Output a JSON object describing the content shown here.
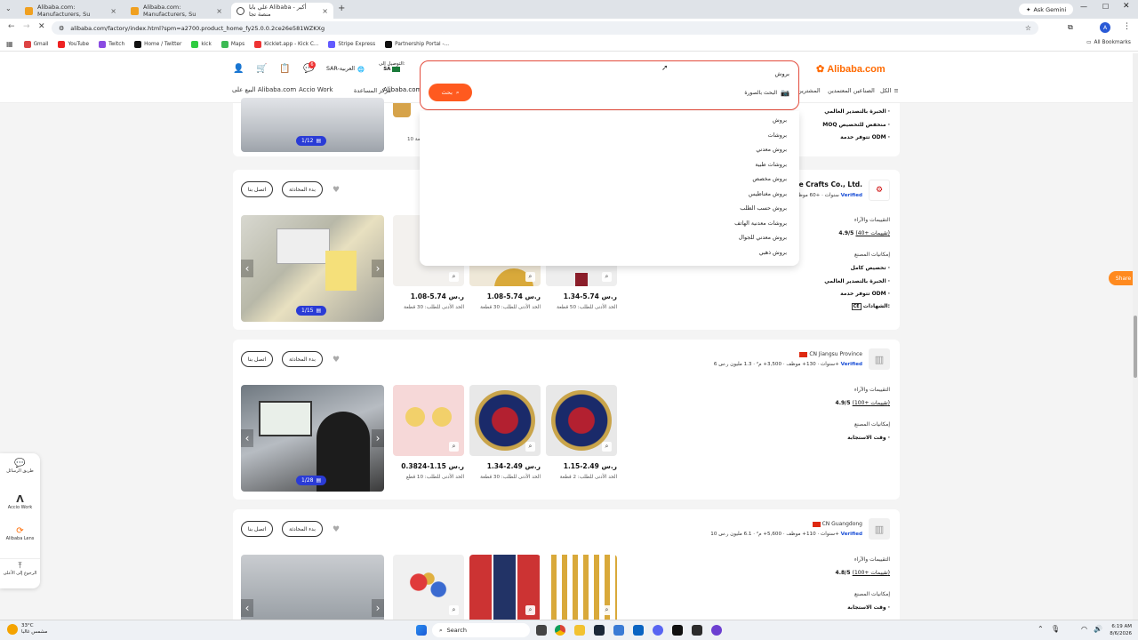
{
  "browser": {
    "tabs": [
      {
        "title": "Alibaba.com: Manufacturers, Su"
      },
      {
        "title": "Alibaba.com: Manufacturers, Su"
      },
      {
        "title": "علي بابا Alibaba - أكبر منصة تجا"
      }
    ],
    "new_tab": "+",
    "ask_gemini": "Ask Gemini",
    "url": "alibaba.com/factory/index.html?spm=a2700.product_home_fy25.0.0.2ce26e581WZKXg",
    "bookmarks": [
      "Gmail",
      "YouTube",
      "Twitch",
      "Home / Twitter",
      "kick",
      "Maps",
      "Kicklet.app - Kick C...",
      "Stripe Express",
      "Partnership Portal -..."
    ],
    "all_bookmarks": "All Bookmarks"
  },
  "site": {
    "logo": "Alibaba.com",
    "currency": "SAR-العربية",
    "deliver_to_label": "التوصيل إلى:",
    "deliver_to_country": "SA",
    "cart_badge": "6",
    "nav": {
      "all": "الكل",
      "verified_manufacturers": "الصناعين المعتمدين",
      "buyers": "المشترين",
      "alibaba_com": "Alibaba.com",
      "help": "مركز المساعدة",
      "accio": "Accio Work",
      "sell": "البيع على Alibaba.com"
    }
  },
  "search": {
    "query": "بروش",
    "image_search": "البحث بالصورة",
    "button": "بحث",
    "suggestions": [
      "بروش",
      "بروشات",
      "بروش معدني",
      "بروشات طبية",
      "بروش مخصص",
      "بروش مغناطيس",
      "بروش حسب الطلب",
      "بروشات معدنية الهاتف",
      "بروش معدني للجوال",
      "بروش ذهبي"
    ]
  },
  "cards": [
    {
      "counter": "1/12",
      "right_lines": [
        "الخبرة بالتصدير العالمي",
        "MOQ منخفض للتخصيص",
        "تتوفر خدمة ODM"
      ],
      "moq_text": "10 قطعة"
    },
    {
      "company": "Dongguan Shengke Crafts Co., Ltd.",
      "meta": "5 سنوات · +60 موظف",
      "verified": "Verified",
      "rating": "4.9/5",
      "reviews": "(40+ تقييمات)",
      "ratings_label": "التقييمات والآراء",
      "capabilities_label": "إمكانيات المصنع",
      "capabilities": [
        "تخصيص كامل",
        "الخبرة بالتصدير العالمي",
        "تتوفر خدمة ODM"
      ],
      "cert_label": "الشهادات:",
      "cert": "CE",
      "counter": "1/15",
      "products": [
        {
          "price": "1.08-5.74 ر.س",
          "moq": "الحد الأدنى للطلب: 30 قطعة"
        },
        {
          "price": "1.08-5.74 ر.س",
          "moq": "الحد الأدنى للطلب: 30 قطعة"
        },
        {
          "price": "1.34-5.74 ر.س",
          "moq": "الحد الأدنى للطلب: 50 قطعة"
        }
      ],
      "start_chat": "بدء المحادثة",
      "contact": "اتصل بنا"
    },
    {
      "location": "CN Jiangsu Province",
      "meta": "6 سنوات · 130+ موظف · 3,500+ م² · 1.3 مليون ر.س+",
      "verified": "Verified",
      "rating": "4.9/5",
      "reviews": "(100+ تقييمات)",
      "ratings_label": "التقييمات والآراء",
      "capabilities_label": "إمكانيات المصنع",
      "capabilities": [
        "وقت الاستجابة"
      ],
      "counter": "1/28",
      "products": [
        {
          "price": "0.3824-1.15 ر.س",
          "moq": "الحد الأدنى للطلب: 10 قطع"
        },
        {
          "price": "1.34-2.49 ر.س",
          "moq": "الحد الأدنى للطلب: 30 قطعة"
        },
        {
          "price": "1.15-2.49 ر.س",
          "moq": "الحد الأدنى للطلب: 2 قطعة"
        }
      ],
      "start_chat": "بدء المحادثة",
      "contact": "اتصل بنا"
    },
    {
      "location": "CN Guangdong",
      "meta": "10 سنوات · 110+ موظف · 5,600+ م² · 6.1 مليون ر.س+",
      "verified": "Verified",
      "rating": "4.8/5",
      "reviews": "(100+ تقييمات)",
      "ratings_label": "التقييمات والآراء",
      "capabilities_label": "إمكانيات المصنع",
      "capabilities": [
        "وقت الاستجابة"
      ],
      "start_chat": "بدء المحادثة",
      "contact": "اتصل بنا"
    }
  ],
  "left_panel": {
    "messages": "طريق الرسائل",
    "accio": "Accio Work",
    "lens": "Alibaba Lens",
    "top": "الرجوع إلى الأعلى"
  },
  "share_tab": "Share",
  "taskbar": {
    "weather_temp": "33°C",
    "weather_desc": "مشمس غالبا",
    "search": "Search",
    "time": "6:19 AM",
    "date": "8/6/2026"
  }
}
